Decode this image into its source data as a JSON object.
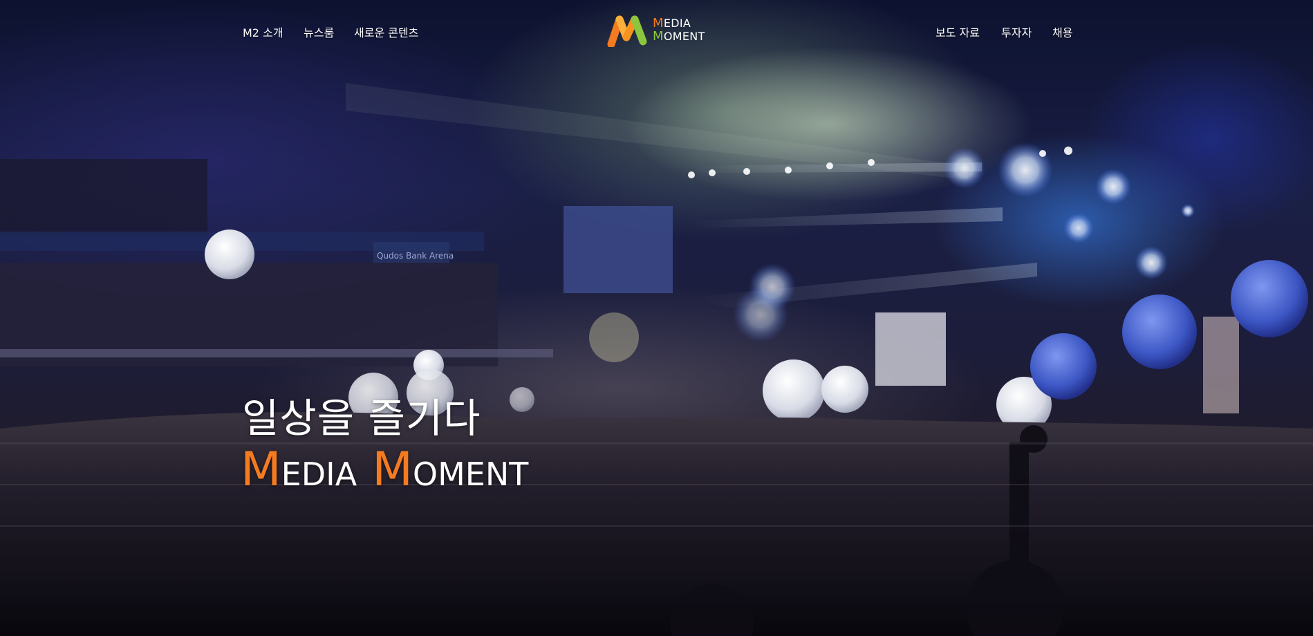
{
  "nav": {
    "left": [
      {
        "label": "M2 소개"
      },
      {
        "label": "뉴스룸"
      },
      {
        "label": "새로운 콘텐츠"
      }
    ],
    "right": [
      {
        "label": "보도 자료"
      },
      {
        "label": "투자자"
      },
      {
        "label": "채용"
      }
    ]
  },
  "logo": {
    "line1_cap": "M",
    "line1_rest": "EDIA",
    "line2_cap": "M",
    "line2_rest": "OMENT",
    "colors": {
      "orange": "#f47b20",
      "yellow": "#fbb03b",
      "green": "#8cc63f"
    }
  },
  "hero": {
    "headline": "일상을 즐기다",
    "brand_word1_cap": "M",
    "brand_word1_rest": "EDIA",
    "brand_word2_cap": "M",
    "brand_word2_rest": "OMENT",
    "accent_color": "#f47b20",
    "arena_sign": "Qudos Bank Arena"
  }
}
